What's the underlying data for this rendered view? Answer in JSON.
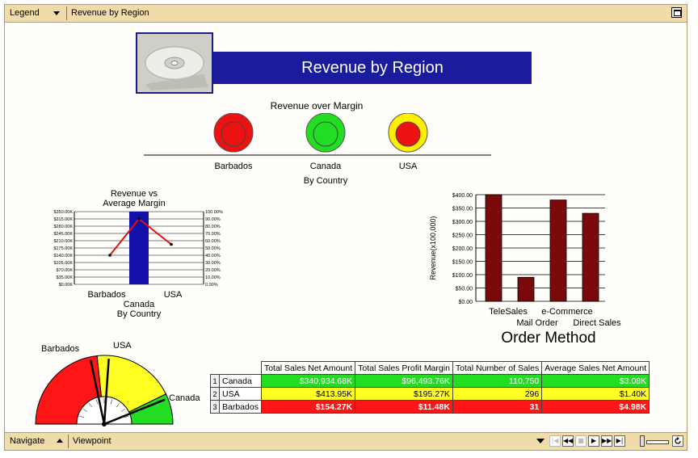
{
  "top_bar": {
    "legend_label": "Legend",
    "view_title": "Revenue by Region"
  },
  "header": {
    "title": "Revenue by Region"
  },
  "traffic": {
    "title": "Revenue over Margin",
    "items": [
      {
        "label": "Barbados",
        "color": "#ee1111",
        "ring": "#ee1111"
      },
      {
        "label": "Canada",
        "color": "#22dd22",
        "ring": "#22dd22"
      },
      {
        "label": "USA",
        "color": "#ee1111",
        "ring": "#ffee00"
      }
    ],
    "axis_label": "By Country"
  },
  "combo_chart": {
    "title_line1": "Revenue vs",
    "title_line2": "Average Margin",
    "xlabel": "By Country",
    "x_labels": [
      "Barbados",
      "Canada",
      "USA"
    ]
  },
  "order_chart": {
    "title": "Order Method",
    "ylabel": "Revenue(x100,000)",
    "x_labels_row1": [
      "TeleSales",
      "e-Commerce"
    ],
    "x_labels_row2": [
      "Mail Order",
      "Direct Sales"
    ]
  },
  "gauge": {
    "labels": [
      "Barbados",
      "USA",
      "Canada"
    ]
  },
  "table": {
    "headers": [
      "Total Sales Net Amount",
      "Total Sales Profit Margin",
      "Total Number of Sales",
      "Average Sales Net Amount"
    ],
    "rows": [
      {
        "index": "1",
        "country": "Canada",
        "values": [
          "$340,934.68K",
          "$96,493.76K",
          "110,750",
          "$3.08K"
        ],
        "style": "cell-green"
      },
      {
        "index": "2",
        "country": "USA",
        "values": [
          "$413.95K",
          "$195.27K",
          "296",
          "$1.40K"
        ],
        "style": "cell-yellow"
      },
      {
        "index": "3",
        "country": "Barbados",
        "values": [
          "$154.27K",
          "$11.48K",
          "31",
          "$4.98K"
        ],
        "style": "cell-red"
      }
    ]
  },
  "bottom_bar": {
    "navigate_label": "Navigate",
    "viewpoint_label": "Viewpoint"
  },
  "chart_data": [
    {
      "type": "bar",
      "title": "Order Method",
      "ylabel": "Revenue(x100,000)",
      "categories": [
        "TeleSales",
        "Mail Order",
        "e-Commerce",
        "Direct Sales"
      ],
      "values": [
        400,
        90,
        380,
        330
      ],
      "ylim": [
        0,
        400
      ],
      "yticks": [
        "$0.00",
        "$50.00",
        "$100.00",
        "$150.00",
        "$200.00",
        "$250.00",
        "$300.00",
        "$350.00",
        "$400.00"
      ],
      "color": "#7a0a0a",
      "grid": true
    },
    {
      "type": "bar",
      "title": "Revenue vs Average Margin",
      "xlabel": "By Country",
      "categories": [
        "Barbados",
        "Canada",
        "USA"
      ],
      "bar_values": [
        0,
        350,
        0
      ],
      "line_values": [
        40,
        90,
        55
      ],
      "ylim_left": [
        0,
        350
      ],
      "ylim_right": [
        0,
        100
      ],
      "yticks_left": [
        "$0.00K",
        "$35.00K",
        "$70.00K",
        "$105.00K",
        "$140.00K",
        "$175.00K",
        "$210.00K",
        "$245.00K",
        "$280.00K",
        "$315.00K",
        "$350.00K"
      ],
      "yticks_right": [
        "0.00%",
        "10.00%",
        "20.00%",
        "30.00%",
        "40.00%",
        "50.00%",
        "60.00%",
        "70.00%",
        "80.00%",
        "90.00%",
        "100.00%"
      ],
      "bar_color": "#1111aa",
      "line_color": "#dd1111"
    }
  ]
}
